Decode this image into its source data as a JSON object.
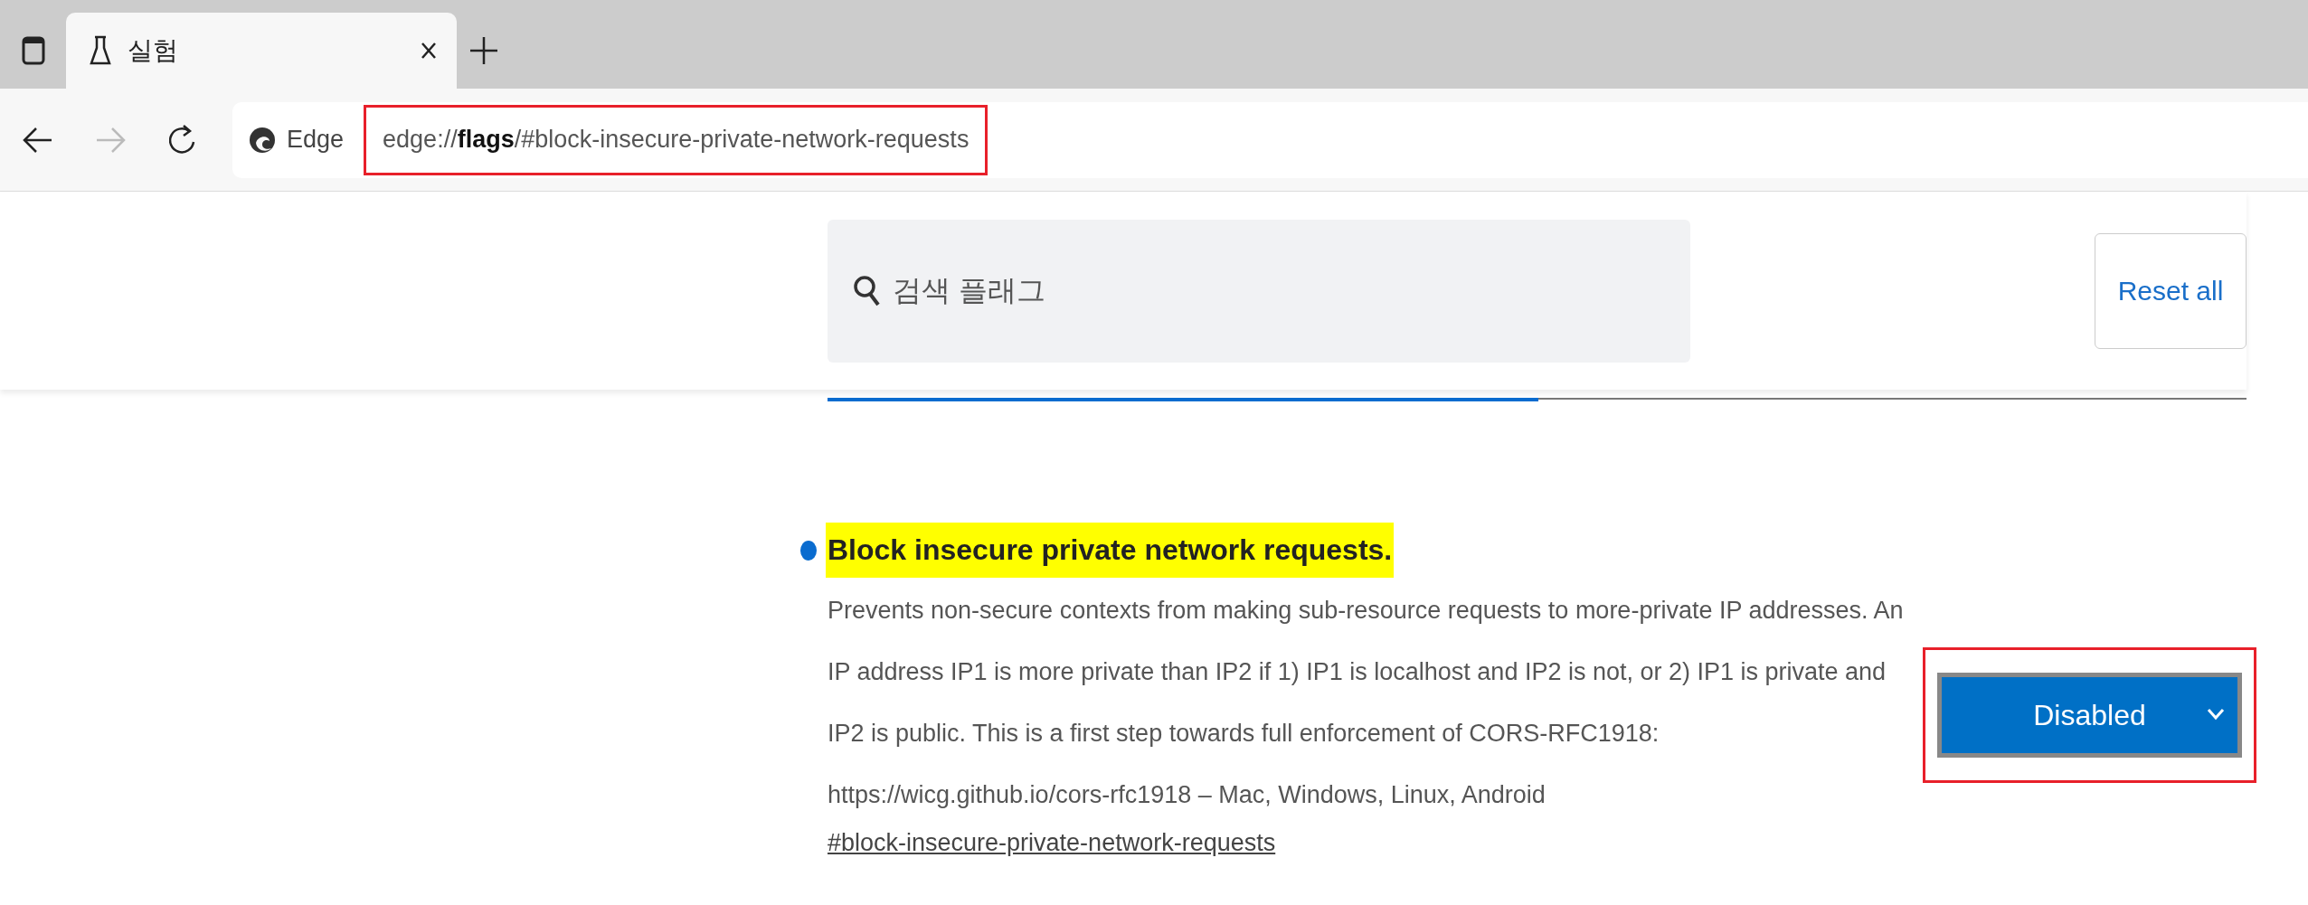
{
  "tabs": [
    {
      "title": "실험",
      "selected": true
    }
  ],
  "address_bar": {
    "site_label": "Edge",
    "url": "edge://**flags**/#block-insecure-private-network-requests"
  },
  "search": {
    "placeholder": "검색 플래그"
  },
  "reset_button": "Reset all",
  "section_tabs": [
    {
      "selected": true
    },
    {
      "selected": false
    }
  ],
  "flags": [
    {
      "title": "Block insecure private network requests.",
      "marked": true,
      "highlighted": true,
      "description": "Prevents non-secure contexts from making sub-resource requests to more-private IP addresses. An IP address IP1 is more private than IP2 if 1) IP1 is localhost and IP2 is not, or 2) IP1 is private and IP2 is public. This is a first step towards full enforcement of CORS-RFC1918: https://wicg.github.io/cors-rfc1918 – Mac, Windows, Linux, Android",
      "anchor": "#block-insecure-private-network-requests",
      "value": "Disabled"
    }
  ]
}
